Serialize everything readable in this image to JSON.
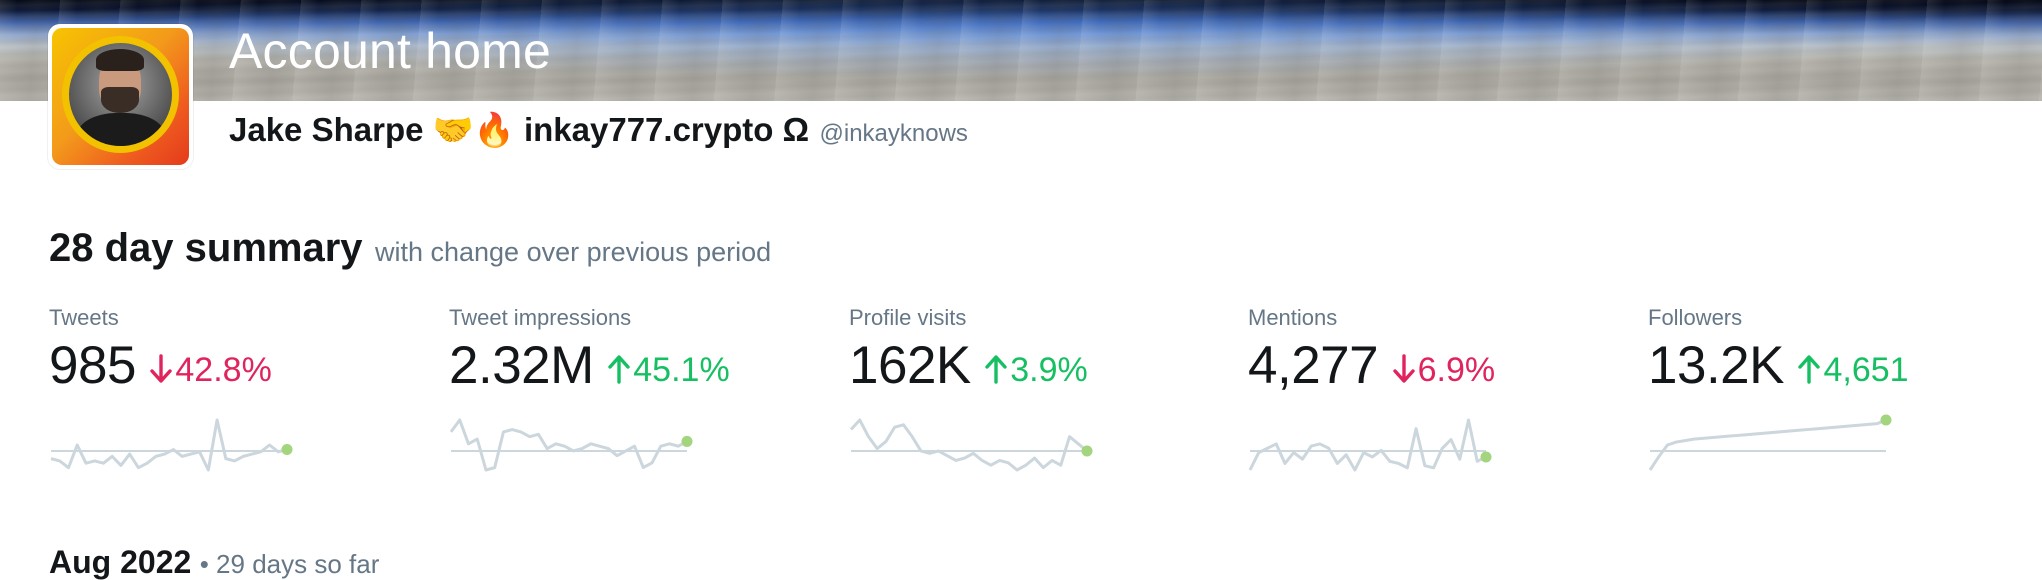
{
  "header": {
    "title": "Account home",
    "display_name": "Jake Sharpe 🤝🔥 inkay777.crypto Ω",
    "handle": "@inkayknows"
  },
  "summary": {
    "title": "28 day summary",
    "subtitle": "with change over previous period",
    "stats": [
      {
        "label": "Tweets",
        "value": "985",
        "change": "42.8%",
        "direction": "down",
        "sparkline": [
          8,
          7,
          4,
          14,
          6,
          7,
          6,
          9,
          5,
          10,
          4,
          6,
          9,
          10,
          12,
          9,
          10,
          11,
          3,
          25,
          8,
          7,
          9,
          10,
          11,
          14,
          11,
          12
        ]
      },
      {
        "label": "Tweet impressions",
        "value": "2.32M",
        "change": "45.1%",
        "direction": "up",
        "sparkline": [
          10,
          15,
          5,
          7,
          -6,
          -5,
          10,
          11,
          10,
          8,
          9,
          3,
          5,
          4,
          2,
          3,
          5,
          4,
          3,
          0,
          2,
          4,
          -5,
          -3,
          4,
          5,
          4,
          6
        ]
      },
      {
        "label": "Profile visits",
        "value": "162K",
        "change": "3.9%",
        "direction": "up",
        "sparkline": [
          7,
          11,
          4,
          -1,
          2,
          8,
          9,
          4,
          -2,
          -3,
          -2,
          -4,
          -6,
          -5,
          -3,
          -6,
          -8,
          -6,
          -7,
          -10,
          -8,
          -5,
          -9,
          -6,
          -8,
          4,
          1,
          -2
        ]
      },
      {
        "label": "Mentions",
        "value": "4,277",
        "change": "6.9%",
        "direction": "down",
        "sparkline": [
          2,
          10,
          12,
          14,
          5,
          10,
          7,
          13,
          14,
          12,
          5,
          9,
          2,
          10,
          8,
          11,
          6,
          5,
          3,
          21,
          4,
          3,
          12,
          16,
          7,
          25,
          6,
          8
        ]
      },
      {
        "label": "Followers",
        "value": "13.2K",
        "change": "4,651",
        "direction": "up",
        "sparkline": [
          0,
          9,
          17,
          19,
          20,
          21,
          21.5,
          22,
          22.5,
          23,
          23.5,
          24,
          24.5,
          25,
          25.5,
          26,
          26.5,
          27,
          27.5,
          28,
          28.5,
          29,
          29.5,
          30,
          30.5,
          31,
          31.5,
          34
        ]
      }
    ]
  },
  "month": {
    "title": "Aug 2022",
    "subtitle": "• 29 days so far"
  },
  "colors": {
    "down": "#e0245e",
    "up": "#17bf63",
    "sparkline": "#ccd6dd",
    "baseline": "#ccd6dd",
    "endpoint": "#a3d47e"
  }
}
